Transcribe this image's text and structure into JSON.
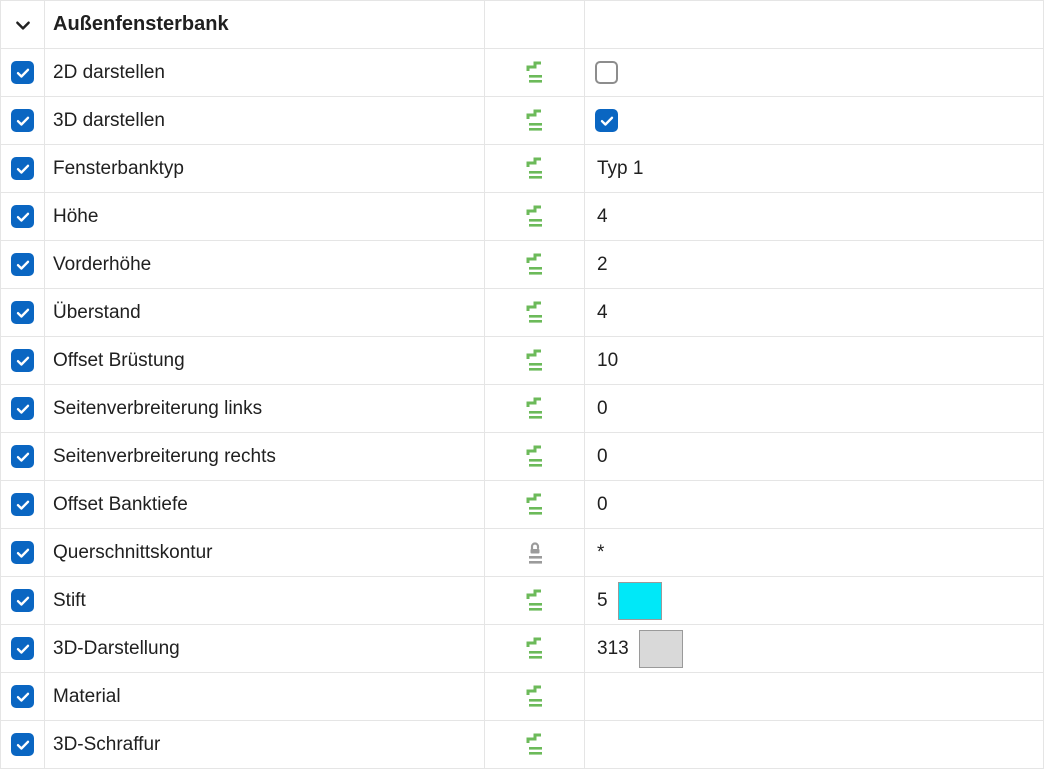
{
  "header": {
    "title": "Außenfensterbank"
  },
  "rows": [
    {
      "label": "2D darstellen",
      "checked": true,
      "mode": "link",
      "value_type": "checkbox",
      "value_checked": false
    },
    {
      "label": "3D darstellen",
      "checked": true,
      "mode": "link",
      "value_type": "checkbox",
      "value_checked": true
    },
    {
      "label": "Fensterbanktyp",
      "checked": true,
      "mode": "link",
      "value_type": "text",
      "value": "Typ 1"
    },
    {
      "label": "Höhe",
      "checked": true,
      "mode": "link",
      "value_type": "text",
      "value": "4"
    },
    {
      "label": "Vorderhöhe",
      "checked": true,
      "mode": "link",
      "value_type": "text",
      "value": "2"
    },
    {
      "label": "Überstand",
      "checked": true,
      "mode": "link",
      "value_type": "text",
      "value": "4"
    },
    {
      "label": "Offset Brüstung",
      "checked": true,
      "mode": "link",
      "value_type": "text",
      "value": "10"
    },
    {
      "label": "Seitenverbreiterung links",
      "checked": true,
      "mode": "link",
      "value_type": "text",
      "value": "0"
    },
    {
      "label": "Seitenverbreiterung rechts",
      "checked": true,
      "mode": "link",
      "value_type": "text",
      "value": "0"
    },
    {
      "label": "Offset Banktiefe",
      "checked": true,
      "mode": "link",
      "value_type": "text",
      "value": "0"
    },
    {
      "label": "Querschnittskontur",
      "checked": true,
      "mode": "lock",
      "value_type": "text",
      "value": "*"
    },
    {
      "label": "Stift",
      "checked": true,
      "mode": "link",
      "value_type": "swatch",
      "value": "5",
      "swatch": "#00e8f8"
    },
    {
      "label": "3D-Darstellung",
      "checked": true,
      "mode": "link",
      "value_type": "swatch",
      "value": "313",
      "swatch": "#d9d9d9"
    },
    {
      "label": "Material",
      "checked": true,
      "mode": "link",
      "value_type": "text",
      "value": ""
    },
    {
      "label": "3D-Schraffur",
      "checked": true,
      "mode": "link",
      "value_type": "text",
      "value": ""
    }
  ]
}
